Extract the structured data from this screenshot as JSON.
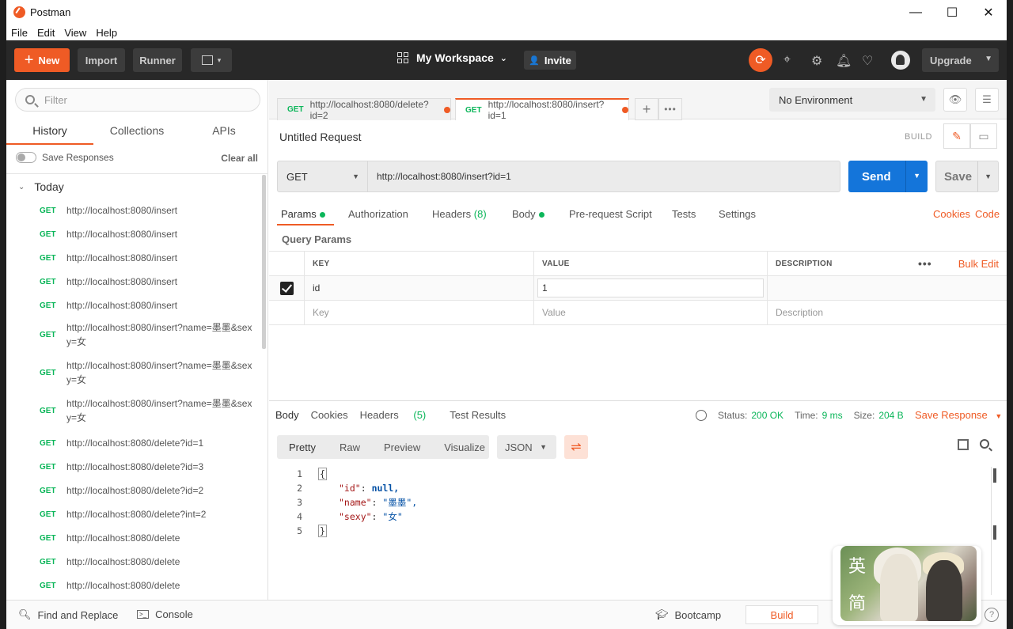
{
  "window": {
    "title": "Postman",
    "minimize": "—",
    "maximize": "☐",
    "close": "✕"
  },
  "menu": [
    "File",
    "Edit",
    "View",
    "Help"
  ],
  "header": {
    "new_label": "New",
    "import_label": "Import",
    "runner_label": "Runner",
    "workspace_label": "My Workspace",
    "invite_label": "Invite",
    "upgrade_label": "Upgrade"
  },
  "sidebar": {
    "filter_placeholder": "Filter",
    "tabs": [
      "History",
      "Collections",
      "APIs"
    ],
    "save_responses_label": "Save Responses",
    "clear_all_label": "Clear all",
    "group_label": "Today",
    "history": [
      {
        "method": "GET",
        "url": "http://localhost:8080/insert"
      },
      {
        "method": "GET",
        "url": "http://localhost:8080/insert"
      },
      {
        "method": "GET",
        "url": "http://localhost:8080/insert"
      },
      {
        "method": "GET",
        "url": "http://localhost:8080/insert"
      },
      {
        "method": "GET",
        "url": "http://localhost:8080/insert"
      },
      {
        "method": "GET",
        "url": "http://localhost:8080/insert?name=墨墨&sexy=女"
      },
      {
        "method": "GET",
        "url": "http://localhost:8080/insert?name=墨墨&sexy=女"
      },
      {
        "method": "GET",
        "url": "http://localhost:8080/insert?name=墨墨&sexy=女"
      },
      {
        "method": "GET",
        "url": "http://localhost:8080/delete?id=1"
      },
      {
        "method": "GET",
        "url": "http://localhost:8080/delete?id=3"
      },
      {
        "method": "GET",
        "url": "http://localhost:8080/delete?id=2"
      },
      {
        "method": "GET",
        "url": "http://localhost:8080/delete?int=2"
      },
      {
        "method": "GET",
        "url": "http://localhost:8080/delete"
      },
      {
        "method": "GET",
        "url": "http://localhost:8080/delete"
      },
      {
        "method": "GET",
        "url": "http://localhost:8080/delete"
      }
    ]
  },
  "request_tabs": [
    {
      "method": "GET",
      "label": "http://localhost:8080/delete?id=2"
    },
    {
      "method": "GET",
      "label": "http://localhost:8080/insert?id=1"
    }
  ],
  "environment": {
    "selected": "No Environment"
  },
  "request": {
    "title": "Untitled Request",
    "build_label": "BUILD",
    "method": "GET",
    "url": "http://localhost:8080/insert?id=1",
    "send_label": "Send",
    "save_label": "Save",
    "tabs": {
      "params": "Params",
      "authorization": "Authorization",
      "headers": "Headers",
      "headers_count": "(8)",
      "body": "Body",
      "pre_request": "Pre-request Script",
      "tests": "Tests",
      "settings": "Settings"
    },
    "cookies_link": "Cookies",
    "code_link": "Code",
    "query_params_label": "Query Params",
    "table_headers": [
      "KEY",
      "VALUE",
      "DESCRIPTION"
    ],
    "bulk_edit_label": "Bulk Edit",
    "params": [
      {
        "key": "id",
        "value": "1",
        "checked": true
      }
    ],
    "placeholders": {
      "key": "Key",
      "value": "Value",
      "description": "Description"
    }
  },
  "response": {
    "tabs": {
      "body": "Body",
      "cookies": "Cookies",
      "headers": "Headers",
      "headers_count": "(5)",
      "test_results": "Test Results"
    },
    "status_label": "Status:",
    "status_value": "200 OK",
    "time_label": "Time:",
    "time_value": "9 ms",
    "size_label": "Size:",
    "size_value": "204 B",
    "save_response_label": "Save Response",
    "view_modes": [
      "Pretty",
      "Raw",
      "Preview",
      "Visualize"
    ],
    "format": "JSON",
    "code_lines": [
      {
        "n": "1",
        "text": "{"
      },
      {
        "n": "2",
        "key": "\"id\"",
        "val": "null,"
      },
      {
        "n": "3",
        "key": "\"name\"",
        "val": "\"墨墨\","
      },
      {
        "n": "4",
        "key": "\"sexy\"",
        "val": "\"女\""
      },
      {
        "n": "5",
        "text": "}"
      }
    ]
  },
  "footer": {
    "find_replace": "Find and Replace",
    "console": "Console",
    "bootcamp": "Bootcamp",
    "build": "Build",
    "help": "?"
  },
  "ime": {
    "char1": "英",
    "char2": "简"
  },
  "colors": {
    "accent": "#ef5b25",
    "send_blue": "#1475da",
    "get_green": "#0cb65a",
    "header_dark": "#282828"
  }
}
